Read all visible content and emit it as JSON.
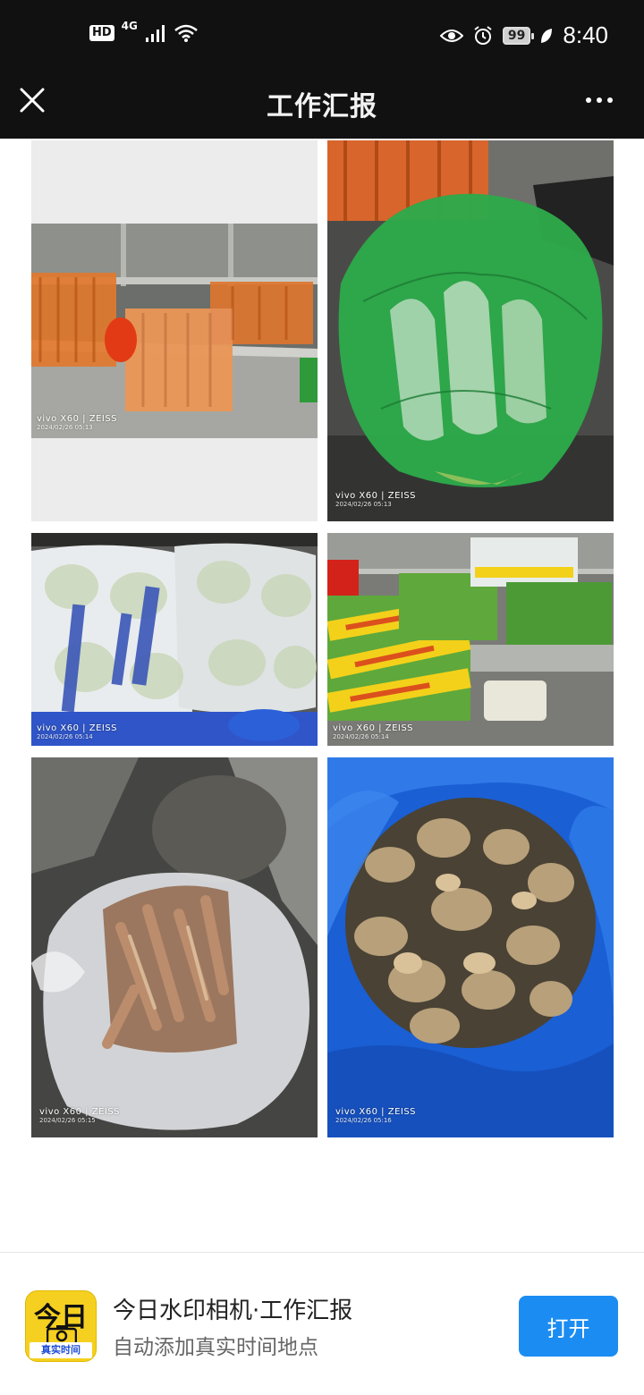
{
  "status_bar": {
    "hd": "HD",
    "network": "4G",
    "battery": "99",
    "time": "8:40"
  },
  "header": {
    "title": "工作汇报"
  },
  "photos": [
    {
      "name": "carrots",
      "brand": "vivo X60 | ZEISS",
      "date": "2024/02/26 05:13"
    },
    {
      "name": "radish-green-bag",
      "brand": "vivo X60 | ZEISS",
      "date": "2024/02/26 05:13"
    },
    {
      "name": "cabbage-bags",
      "brand": "vivo X60 | ZEISS",
      "date": "2024/02/26 05:14"
    },
    {
      "name": "greens-bundles",
      "brand": "vivo X60 | ZEISS",
      "date": "2024/02/26 05:14"
    },
    {
      "name": "sweet-potatoes",
      "brand": "vivo X60 | ZEISS",
      "date": "2024/02/26 05:15"
    },
    {
      "name": "ginger-blue-bag",
      "brand": "vivo X60 | ZEISS",
      "date": "2024/02/26 05:16"
    }
  ],
  "footer": {
    "logo_main": "今日",
    "logo_sub": "真实时间",
    "app_title": "今日水印相机·工作汇报",
    "app_subtitle": "自动添加真实时间地点",
    "open_label": "打开"
  }
}
